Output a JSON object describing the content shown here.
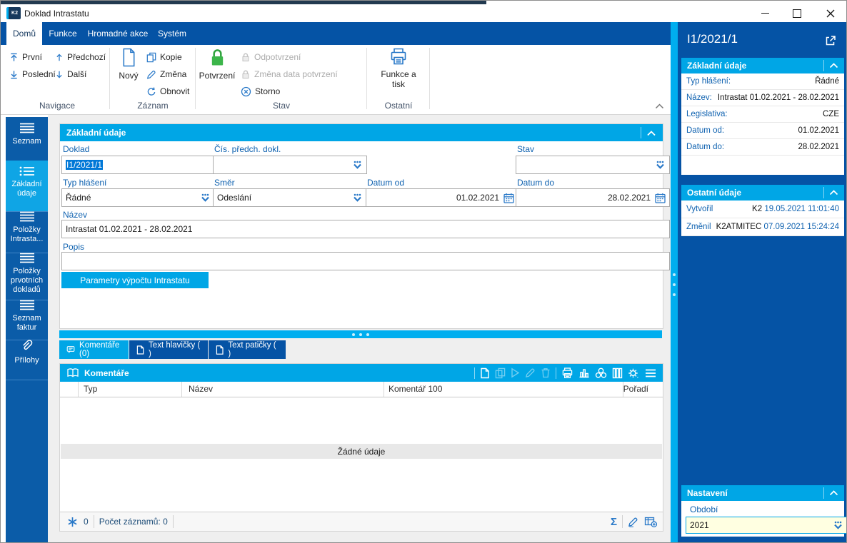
{
  "window": {
    "logo_text": "K2",
    "title": "Doklad Intrastatu"
  },
  "ribbon": {
    "tabs": {
      "home": "Domů",
      "functions": "Funkce",
      "bulk": "Hromadné akce",
      "system": "Systém"
    },
    "navigace": {
      "group_label": "Navigace",
      "first": "První",
      "last": "Poslední",
      "previous": "Předchozí",
      "next": "Další"
    },
    "zaznam": {
      "group_label": "Záznam",
      "new": "Nový",
      "copy": "Kopie",
      "edit": "Změna",
      "refresh": "Obnovit"
    },
    "stav": {
      "group_label": "Stav",
      "confirm": "Potvrzení",
      "unconfirm": "Odpotvrzení",
      "change_date": "Změna data potvrzení",
      "cancel": "Storno"
    },
    "ostatni": {
      "group_label": "Ostatní",
      "functions_print": "Funkce a tisk"
    }
  },
  "sidebar": {
    "items": [
      {
        "label": "Seznam"
      },
      {
        "label": "Základní údaje"
      },
      {
        "label": "Položky Intrasta..."
      },
      {
        "label": "Položky prvotních dokladů"
      },
      {
        "label": "Seznam faktur"
      },
      {
        "label": "Přílohy"
      }
    ]
  },
  "form": {
    "section_title": "Základní údaje",
    "doklad_label": "Doklad",
    "doklad_value": "I1/2021/1",
    "predch_label": "Čís. předch. dokl.",
    "predch_value": "",
    "stav_label": "Stav",
    "stav_value": "",
    "typ_label": "Typ hlášení",
    "typ_value": "Řádné",
    "smer_label": "Směr",
    "smer_value": "Odeslání",
    "datum_od_label": "Datum od",
    "datum_od_value": "01.02.2021",
    "datum_do_label": "Datum do",
    "datum_do_value": "28.02.2021",
    "nazev_label": "Název",
    "nazev_value": "Intrastat 01.02.2021 - 28.02.2021",
    "popis_label": "Popis",
    "popis_value": "",
    "params_button": "Parametry výpočtu Intrastatu"
  },
  "detail_tabs": {
    "comments": "Komentáře (0)",
    "header_text": "Text hlavičky ( )",
    "footer_text": "Text patičky ( )"
  },
  "comments_grid": {
    "title": "Komentáře",
    "columns": {
      "typ": "Typ",
      "nazev": "Název",
      "komentar": "Komentář 100",
      "poradi": "Pořadí"
    },
    "empty_text": "Žádné údaje",
    "selected_count": "0",
    "record_count_label": "Počet záznamů: 0"
  },
  "right_panel": {
    "title": "I1/2021/1",
    "basic": {
      "title": "Základní údaje",
      "rows": [
        {
          "label": "Typ hlášení:",
          "value": "Řádné"
        },
        {
          "label": "Název:",
          "value": "Intrastat 01.02.2021 - 28.02.2021"
        },
        {
          "label": "Legislativa:",
          "value": "CZE"
        },
        {
          "label": "Datum od:",
          "value": "01.02.2021"
        },
        {
          "label": "Datum do:",
          "value": "28.02.2021"
        }
      ]
    },
    "ostatni": {
      "title": "Ostatní údaje",
      "rows": [
        {
          "label": "Vytvořil",
          "user": "K2",
          "timestamp": "19.05.2021 11:01:40"
        },
        {
          "label": "Změnil",
          "user": "K2ATMITEC",
          "timestamp": "07.09.2021 15:24:24"
        }
      ]
    },
    "nastaveni": {
      "title": "Nastavení",
      "obdobi_label": "Období",
      "obdobi_value": "2021"
    }
  },
  "colors": {
    "accent_cyan": "#00A6E6",
    "dark_blue": "#0553A5",
    "sidebar_blue": "#0B5CA8",
    "label_blue": "#0F62B0",
    "confirm_green": "#3CB54A",
    "selection_blue": "#0078D7",
    "period_field_bg": "#FFFFE1",
    "splitter_cyan": "#00AEEF"
  }
}
